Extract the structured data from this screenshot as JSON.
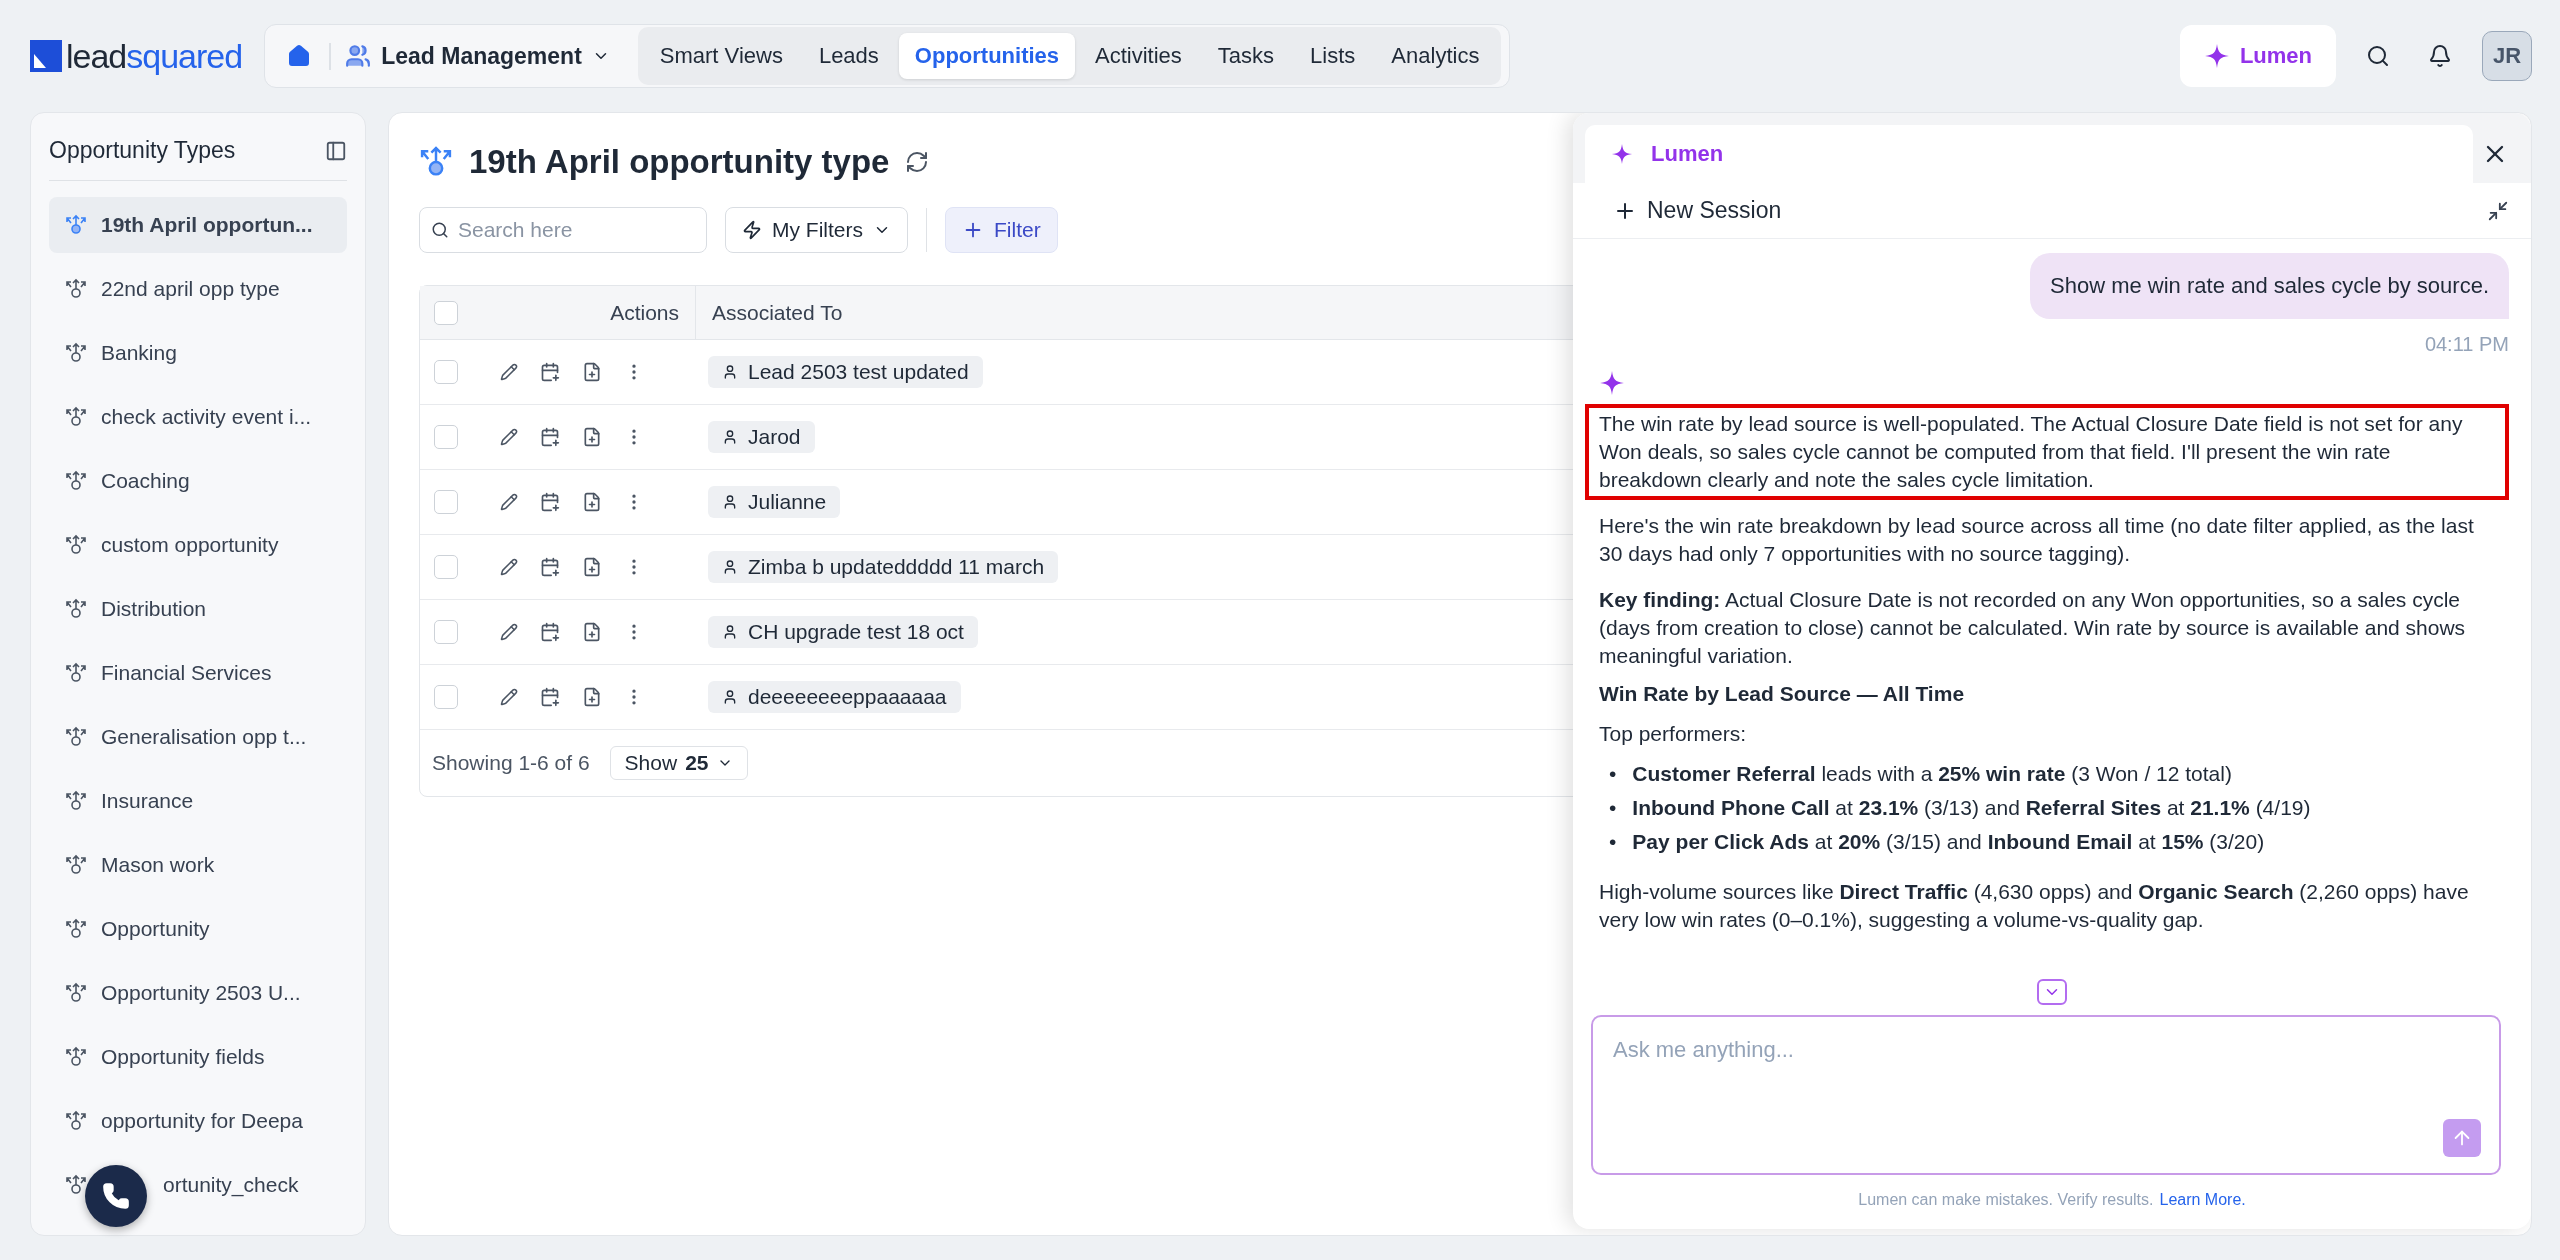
{
  "logo": {
    "parts": [
      "lead",
      "squared"
    ]
  },
  "topnav": {
    "module": "Lead Management",
    "tabs": [
      {
        "label": "Smart Views",
        "selected": false
      },
      {
        "label": "Leads",
        "selected": false
      },
      {
        "label": "Opportunities",
        "selected": true
      },
      {
        "label": "Activities",
        "selected": false
      },
      {
        "label": "Tasks",
        "selected": false
      },
      {
        "label": "Lists",
        "selected": false
      },
      {
        "label": "Analytics",
        "selected": false
      }
    ],
    "lumen_button": "Lumen",
    "avatar": "JR"
  },
  "sidebar": {
    "title": "Opportunity Types",
    "items": [
      {
        "label": "19th April opportun...",
        "selected": true
      },
      {
        "label": "22nd april opp type",
        "selected": false
      },
      {
        "label": "Banking",
        "selected": false
      },
      {
        "label": "check activity event i...",
        "selected": false
      },
      {
        "label": "Coaching",
        "selected": false
      },
      {
        "label": "custom opportunity",
        "selected": false
      },
      {
        "label": "Distribution",
        "selected": false
      },
      {
        "label": "Financial Services",
        "selected": false
      },
      {
        "label": "Generalisation opp t...",
        "selected": false
      },
      {
        "label": "Insurance",
        "selected": false
      },
      {
        "label": "Mason work",
        "selected": false
      },
      {
        "label": "Opportunity",
        "selected": false
      },
      {
        "label": "Opportunity 2503 U...",
        "selected": false
      },
      {
        "label": "Opportunity fields",
        "selected": false
      },
      {
        "label": "opportunity for Deepa",
        "selected": false
      },
      {
        "label": "ortunity_check",
        "selected": false
      }
    ]
  },
  "main": {
    "title": "19th April opportunity type",
    "search": {
      "placeholder": "Search here"
    },
    "my_filters": "My Filters",
    "filter_button": "Filter",
    "table": {
      "select_all_checked": false,
      "columns": [
        "Actions",
        "Associated To"
      ],
      "rows": [
        {
          "checked": false,
          "associated_to": "Lead 2503 test updated"
        },
        {
          "checked": false,
          "associated_to": "Jarod"
        },
        {
          "checked": false,
          "associated_to": "Julianne"
        },
        {
          "checked": false,
          "associated_to": "Zimba b updateddddd 11 march"
        },
        {
          "checked": false,
          "associated_to": "CH upgrade test 18 oct"
        },
        {
          "checked": false,
          "associated_to": "deeeeeeeeppaaaaaa"
        }
      ]
    },
    "showing": "Showing 1-6 of 6",
    "page_size": {
      "label": "Show",
      "value": "25"
    }
  },
  "lumen_panel": {
    "tab": "Lumen",
    "new_session": "New Session",
    "user_message": {
      "text": "Show me win rate and sales cycle by source.",
      "time": "04:11 PM"
    },
    "reply": [
      {
        "kind": "paragraph",
        "text": "The win rate by lead source is well-populated. The Actual Closure Date field is not set for any Won deals, so sales cycle cannot be computed from that field. I'll present the win rate breakdown clearly and note the sales cycle limitation.",
        "highlighted": true
      },
      {
        "kind": "paragraph",
        "text": "Here's the win rate breakdown by lead source across all time (no date filter applied, as the last 30 days had only 7 opportunities with no source tagging).",
        "highlighted": false
      },
      {
        "kind": "paragraph",
        "text": "**Key finding:** Actual Closure Date is not recorded on any Won opportunities, so a sales cycle (days from creation to close) cannot be calculated. Win rate by source is available and shows meaningful variation.",
        "highlighted": false
      },
      {
        "kind": "heading",
        "text": "Win Rate by Lead Source — All Time"
      },
      {
        "kind": "paragraph",
        "text": "Top performers:",
        "highlighted": false
      },
      {
        "kind": "bullets",
        "marker": "•",
        "items": [
          "**Customer Referral** leads with a **25% win rate** (3 Won / 12 total)",
          "**Inbound Phone Call** at **23.1%** (3/13) and **Referral Sites** at **21.1%** (4/19)",
          "**Pay per Click Ads** at **20%** (3/15) and **Inbound Email** at **15%** (3/20)"
        ]
      },
      {
        "kind": "paragraph",
        "text": "High-volume sources like **Direct Traffic** (4,630 opps) and **Organic Search** (2,260 opps) have very low win rates (0–0.1%), suggesting a volume-vs-quality gap.",
        "highlighted": false
      }
    ],
    "input": {
      "placeholder": "Ask me anything..."
    },
    "disclaimer": "Lumen can make mistakes. Verify results.",
    "learn_more": "Learn More."
  }
}
